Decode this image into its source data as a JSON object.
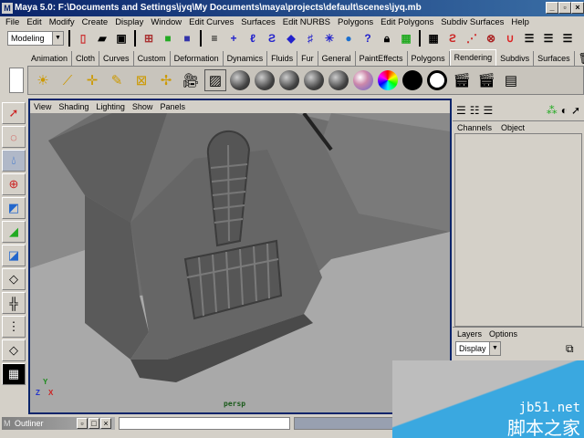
{
  "title": "Maya 5.0: F:\\Documents and Settings\\jyq\\My Documents\\maya\\projects\\default\\scenes\\jyq.mb",
  "menu": [
    "File",
    "Edit",
    "Modify",
    "Create",
    "Display",
    "Window",
    "Edit Curves",
    "Surfaces",
    "Edit NURBS",
    "Polygons",
    "Edit Polygons",
    "Subdiv Surfaces",
    "Help"
  ],
  "mode": "Modeling",
  "shelf_tabs": [
    "Animation",
    "Cloth",
    "Curves",
    "Custom",
    "Deformation",
    "Dynamics",
    "Fluids",
    "Fur",
    "General",
    "PaintEffects",
    "Polygons",
    "Rendering",
    "Subdivs",
    "Surfaces"
  ],
  "active_tab": "Rendering",
  "viewport": {
    "menu": [
      "View",
      "Shading",
      "Lighting",
      "Show",
      "Panels"
    ],
    "camera": "persp",
    "axis": {
      "y": "Y",
      "z": "Z",
      "x": "X"
    }
  },
  "channels": {
    "menu": [
      "Channels",
      "Object"
    ]
  },
  "layers": {
    "menu": [
      "Layers",
      "Options"
    ],
    "display": "Display"
  },
  "bottom": {
    "outliner": "Outliner"
  },
  "watermark": {
    "site": "jb51.net",
    "name": "脚本之家"
  }
}
